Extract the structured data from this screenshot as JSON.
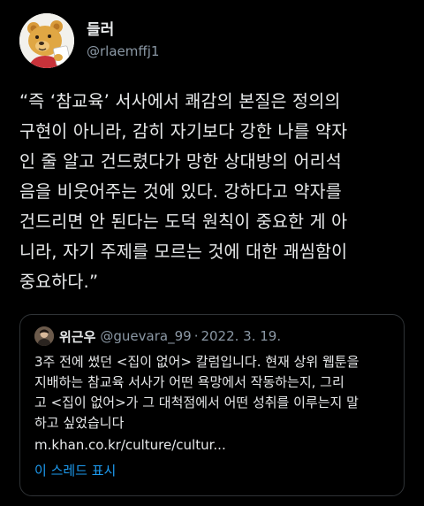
{
  "author": {
    "display_name": "들러",
    "handle": "@rlaemffj1"
  },
  "tweet": {
    "text": "“즉 ‘참교육’ 서사에서 쾌감의 본질은 정의의\n구현이 아니라, 감히 자기보다 강한 나를 약자\n인 줄 알고 건드렸다가 망한 상대방의 어리석\n음을 비웃어주는 것에 있다. 강하다고 약자를\n건드리면 안 된다는 도덕 원칙이 중요한 게 아\n니라, 자기 주제를 모르는 것에 대한 괘씸함이\n중요하다.”"
  },
  "quote": {
    "display_name": "위근우",
    "handle": "@guevara_99",
    "separator": "·",
    "date": "2022. 3. 19.",
    "text": "3주 전에 썼던 <집이 없어> 칼럼입니다. 현재 상위 웹툰을\n지배하는 참교육 서사가 어떤 욕망에서 작동하는지, 그리\n고 <집이 없어>가 그 대척점에서 어떤 성취를 이루는지 말\n하고 싶었습니다",
    "link": "m.khan.co.kr/culture/cultur...",
    "show_thread": "이 스레드 표시"
  },
  "colors": {
    "background": "#000000",
    "text_primary": "#e7e9ea",
    "text_secondary": "#8b98a5",
    "border": "#2f3336",
    "accent": "#1d9bf0"
  },
  "icons": {
    "author_avatar": "bear-character-avatar",
    "quote_avatar": "person-photo-avatar"
  }
}
